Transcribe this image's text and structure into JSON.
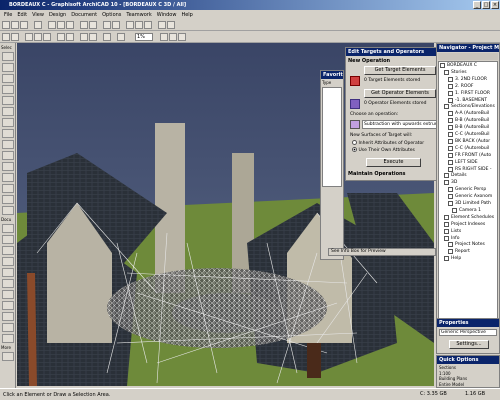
{
  "window": {
    "title": "BORDEAUX C - Graphisoft ArchiCAD 10 - [BORDEAUX C 3D / All]"
  },
  "menu": [
    "File",
    "Edit",
    "View",
    "Design",
    "Document",
    "Options",
    "Teamwork",
    "Window",
    "Help"
  ],
  "toolbar": {
    "zoom_value": "1%"
  },
  "toolbox": {
    "select_label": "Selec",
    "doc_label": "Docu",
    "more_label": "More"
  },
  "palette": {
    "title": "Favorites",
    "search_label": "Type",
    "hint": "See Info Box for Preview"
  },
  "operators": {
    "title": "Edit Targets and Operators",
    "new_operation": "New Operation",
    "get_targets": "Get Target Elements",
    "target_status": "0 Target Elements stored",
    "get_operators": "Get Operator Elements",
    "operator_status": "0 Operator Elements stored",
    "choose_label": "Choose an operation:",
    "operation_value": "Subtraction with upwards extrusion",
    "new_surfaces_label": "New Surfaces of Target will:",
    "radio_inherit": "Inherit Attributes of Operator",
    "radio_own": "Use Their Own Attributes",
    "execute": "Execute",
    "maintain": "Maintain Operations"
  },
  "navigator": {
    "title": "Navigator - Project Map",
    "items": [
      {
        "label": "BORDEAUX C",
        "indent": 0
      },
      {
        "label": "Stories",
        "indent": 1
      },
      {
        "label": "3. 2ND FLOOR",
        "indent": 2
      },
      {
        "label": "2. ROOF",
        "indent": 2
      },
      {
        "label": "1. FIRST FLOOR",
        "indent": 2
      },
      {
        "label": "-1. BASEMENT",
        "indent": 2
      },
      {
        "label": "Sections/Elevations",
        "indent": 1
      },
      {
        "label": "A-A (AutoreBuil",
        "indent": 2
      },
      {
        "label": "B-B (AutoreBuil",
        "indent": 2
      },
      {
        "label": "B-B (AutoreBuil",
        "indent": 2
      },
      {
        "label": "C-C (AutoreBuil",
        "indent": 2
      },
      {
        "label": "BK BACK (Autor",
        "indent": 2
      },
      {
        "label": "C-C (Autorebuil",
        "indent": 2
      },
      {
        "label": "FR FRONT (Auto",
        "indent": 2
      },
      {
        "label": "LEFT SIDE",
        "indent": 2
      },
      {
        "label": "RS RIGHT SIDE -",
        "indent": 2
      },
      {
        "label": "Details",
        "indent": 1
      },
      {
        "label": "3D",
        "indent": 1
      },
      {
        "label": "Generic Persp",
        "indent": 2
      },
      {
        "label": "Generic Axonom",
        "indent": 2
      },
      {
        "label": "3D Limited Path",
        "indent": 2
      },
      {
        "label": "Camera 1",
        "indent": 3
      },
      {
        "label": "Element Schedules",
        "indent": 1
      },
      {
        "label": "Project Indexes",
        "indent": 1
      },
      {
        "label": "Lists",
        "indent": 1
      },
      {
        "label": "Info",
        "indent": 1
      },
      {
        "label": "Project Notes",
        "indent": 2
      },
      {
        "label": "Report",
        "indent": 2
      },
      {
        "label": "Help",
        "indent": 1
      }
    ]
  },
  "properties": {
    "title": "Properties",
    "view_name": "Generic Perspective",
    "settings": "Settings..."
  },
  "quick_options": {
    "title": "Quick Options",
    "items": [
      "Sections",
      "1:100",
      "Building Plans",
      "Entire Model"
    ]
  },
  "status": {
    "hint": "Click an Element or Draw a Selection Area.",
    "disk": "C: 3.35 GB",
    "ram": "1.16 GB"
  },
  "colors": {
    "title_bar": "#0a246a",
    "sky": "#3c4868",
    "ground": "#6e8a3a",
    "roof": "#2a3038",
    "wall": "#b8b3a4"
  }
}
